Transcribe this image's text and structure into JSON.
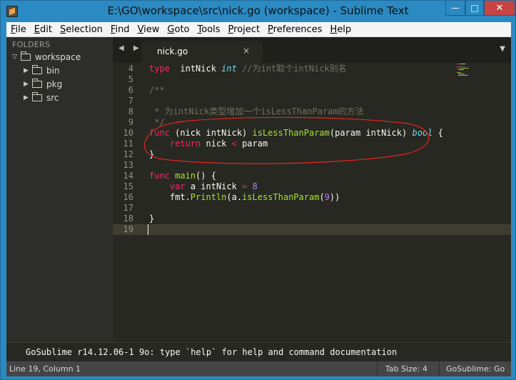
{
  "window": {
    "title": "E:\\GO\\workspace\\src\\nick.go (workspace) - Sublime Text",
    "minimize": "—",
    "maximize": "□",
    "close": "✕"
  },
  "menu": [
    "File",
    "Edit",
    "Selection",
    "Find",
    "View",
    "Goto",
    "Tools",
    "Project",
    "Preferences",
    "Help"
  ],
  "sidebar": {
    "heading": "FOLDERS",
    "root": "workspace",
    "items": [
      "bin",
      "pkg",
      "src"
    ]
  },
  "tab": {
    "label": "nick.go",
    "close": "×",
    "nav": "◀ ▶",
    "menu": "▼"
  },
  "code": {
    "lines": [
      {
        "n": "4",
        "tokens": [
          [
            "kw",
            "type"
          ],
          [
            "",
            "  intNick "
          ],
          [
            "st",
            "int"
          ],
          [
            "cm",
            " //为int取个intNick别名"
          ]
        ]
      },
      {
        "n": "5",
        "tokens": []
      },
      {
        "n": "6",
        "tokens": [
          [
            "cm",
            "/**"
          ]
        ]
      },
      {
        "n": "7",
        "tokens": []
      },
      {
        "n": "8",
        "tokens": [
          [
            "cm",
            " * 为intNick类型增加一个isLessThanParam的方法"
          ]
        ]
      },
      {
        "n": "9",
        "tokens": [
          [
            "cm",
            " */"
          ]
        ]
      },
      {
        "n": "10",
        "tokens": [
          [
            "kw",
            "func"
          ],
          [
            "",
            " (nick intNick) "
          ],
          [
            "fn",
            "isLessThanParam"
          ],
          [
            "",
            "(param intNick) "
          ],
          [
            "st",
            "bool"
          ],
          [
            "",
            " {"
          ]
        ]
      },
      {
        "n": "11",
        "tokens": [
          [
            "",
            "    "
          ],
          [
            "kw",
            "return"
          ],
          [
            "",
            " nick "
          ],
          [
            "kw",
            "<"
          ],
          [
            "",
            " param"
          ]
        ]
      },
      {
        "n": "12",
        "tokens": [
          [
            "",
            "}"
          ]
        ]
      },
      {
        "n": "13",
        "tokens": []
      },
      {
        "n": "14",
        "tokens": [
          [
            "kw",
            "func"
          ],
          [
            "",
            " "
          ],
          [
            "fn",
            "main"
          ],
          [
            "",
            "() {"
          ]
        ]
      },
      {
        "n": "15",
        "tokens": [
          [
            "",
            "    "
          ],
          [
            "kw",
            "var"
          ],
          [
            "",
            " a intNick "
          ],
          [
            "kw",
            "="
          ],
          [
            "",
            " "
          ],
          [
            "nm",
            "8"
          ]
        ]
      },
      {
        "n": "16",
        "tokens": [
          [
            "",
            "    fmt."
          ],
          [
            "fn",
            "Println"
          ],
          [
            "",
            "(a."
          ],
          [
            "fn",
            "isLessThanParam"
          ],
          [
            "",
            "("
          ],
          [
            "nm",
            "9"
          ],
          [
            "",
            "))"
          ]
        ]
      },
      {
        "n": "17",
        "tokens": []
      },
      {
        "n": "18",
        "tokens": [
          [
            "",
            "}"
          ]
        ]
      },
      {
        "n": "19",
        "tokens": []
      }
    ],
    "current_line": "19"
  },
  "console": {
    "text": "GoSublime r14.12.06-1 9o: type `help` for help and command documentation"
  },
  "status": {
    "position": "Line 19, Column 1",
    "tab_size": "Tab Size: 4",
    "syntax": "GoSublime: Go"
  },
  "colors": {
    "keyword": "#f92672",
    "storage": "#66d9ef",
    "function": "#a6e22e",
    "comment": "#75715e",
    "number": "#ae81ff",
    "annotation": "#e8231d"
  }
}
